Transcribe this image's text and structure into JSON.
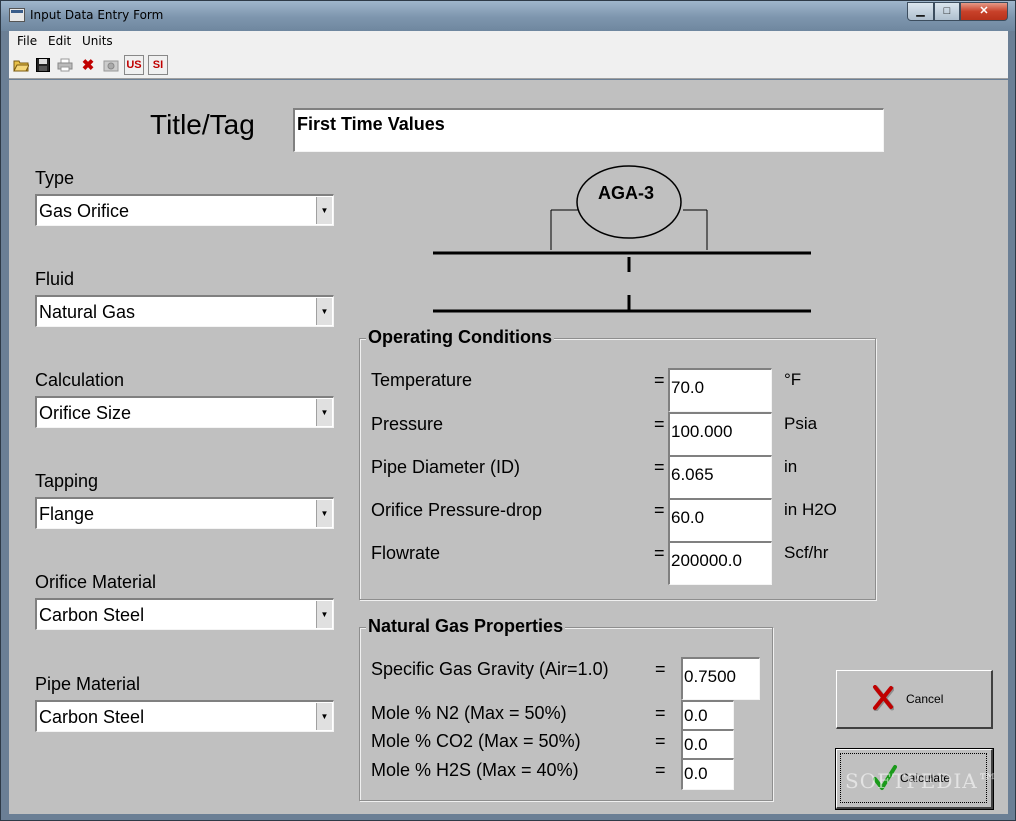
{
  "window": {
    "title": "Input Data Entry Form",
    "controls": {
      "minimize": "▁",
      "maximize": "□",
      "close": "✕"
    }
  },
  "menu": [
    "File",
    "Edit",
    "Units"
  ],
  "toolbar": {
    "us_label": "US",
    "si_label": "SI",
    "icons": [
      "open-folder-icon",
      "save-icon",
      "print-icon",
      "delete-icon",
      "camera-icon",
      "units-us-icon",
      "units-si-icon"
    ]
  },
  "title_tag": {
    "label": "Title/Tag",
    "value": "First Time Values"
  },
  "selectors": [
    {
      "label": "Type",
      "value": "Gas Orifice"
    },
    {
      "label": "Fluid",
      "value": "Natural Gas"
    },
    {
      "label": "Calculation",
      "value": "Orifice Size"
    },
    {
      "label": "Tapping",
      "value": "Flange"
    },
    {
      "label": "Orifice Material",
      "value": "Carbon Steel"
    },
    {
      "label": "Pipe Material",
      "value": "Carbon Steel"
    }
  ],
  "diagram": {
    "meter_label": "AGA-3"
  },
  "operating_conditions": {
    "title": "Operating Conditions",
    "rows": [
      {
        "label": "Temperature",
        "eq": "=",
        "value": "70.0",
        "unit": "°F"
      },
      {
        "label": "Pressure",
        "eq": "=",
        "value": "100.000",
        "unit": "Psia"
      },
      {
        "label": "Pipe Diameter (ID)",
        "eq": "=",
        "value": "6.065",
        "unit": "in"
      },
      {
        "label": "Orifice Pressure-drop",
        "eq": "=",
        "value": "60.0",
        "unit": "in H2O"
      },
      {
        "label": "Flowrate",
        "eq": "=",
        "value": "200000.0",
        "unit": "Scf/hr"
      }
    ]
  },
  "gas_properties": {
    "title": "Natural Gas Properties",
    "rows": [
      {
        "label": "Specific Gas Gravity (Air=1.0)",
        "eq": "=",
        "value": "0.7500"
      },
      {
        "label": "Mole % N2 (Max = 50%)",
        "eq": "=",
        "value": "0.0"
      },
      {
        "label": "Mole % CO2 (Max = 50%)",
        "eq": "=",
        "value": "0.0"
      },
      {
        "label": "Mole % H2S (Max = 40%)",
        "eq": "=",
        "value": "0.0"
      }
    ]
  },
  "buttons": {
    "cancel": "Cancel",
    "calculate": "Calculate"
  },
  "colors": {
    "client_bg": "#c0c0c0",
    "cancel_x": "#c00000",
    "check_green": "#1a9a1a"
  },
  "watermark": "SOFTPEDIA™"
}
